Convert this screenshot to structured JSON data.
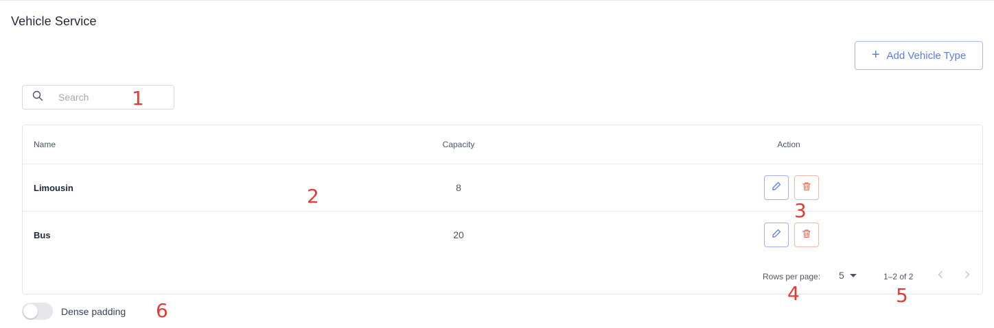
{
  "page": {
    "title": "Vehicle Service"
  },
  "toolbar": {
    "add_label": "Add Vehicle Type",
    "add_icon": "plus-icon"
  },
  "search": {
    "placeholder": "Search",
    "value": "",
    "icon": "search-icon"
  },
  "table": {
    "columns": [
      "Name",
      "Capacity",
      "Action"
    ],
    "rows": [
      {
        "name": "Limousin",
        "capacity": "8"
      },
      {
        "name": "Bus",
        "capacity": "20"
      }
    ],
    "row_actions": [
      "edit-icon",
      "trash-icon"
    ]
  },
  "pagination": {
    "rows_per_page_label": "Rows per page:",
    "rows_per_page_value": "5",
    "range_text": "1–2 of 2",
    "prev_icon": "chevron-left-icon",
    "next_icon": "chevron-right-icon"
  },
  "dense": {
    "label": "Dense padding",
    "enabled": false
  },
  "annotations": [
    "1",
    "2",
    "3",
    "4",
    "5",
    "6"
  ],
  "colors": {
    "accent": "#5b7be9",
    "danger": "#ef6b5a",
    "annotation": "#e53935"
  }
}
